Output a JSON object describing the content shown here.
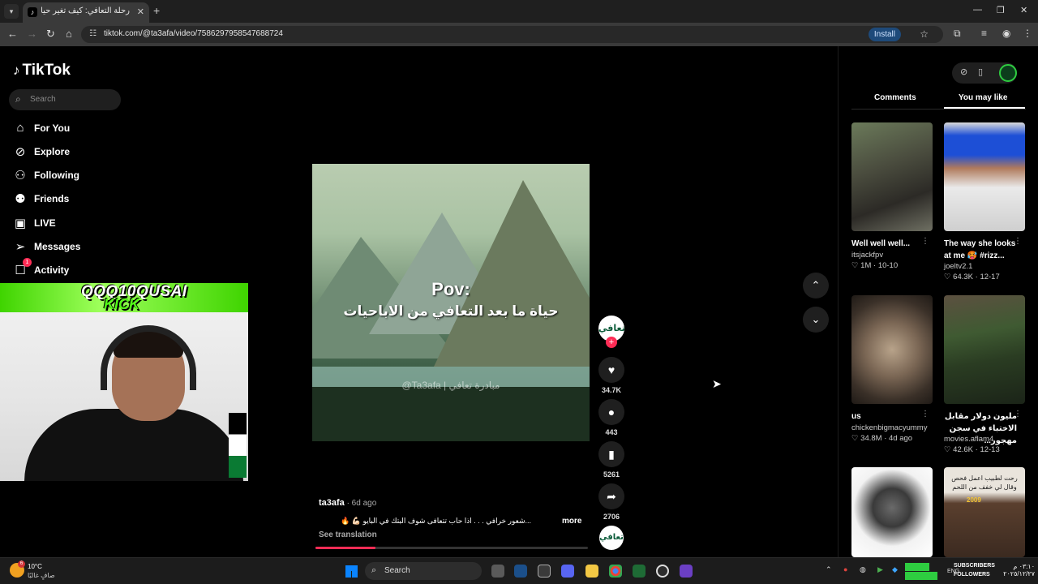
{
  "browser": {
    "tab_title": "رحلة التعافي: كيف تغير حياتك",
    "url": "tiktok.com/@ta3afa/video/7586297958547688724",
    "install_label": "Install"
  },
  "tiktok": {
    "logo": "TikTok",
    "search_placeholder": "Search",
    "nav": [
      {
        "label": "For You"
      },
      {
        "label": "Explore"
      },
      {
        "label": "Following"
      },
      {
        "label": "Friends"
      },
      {
        "label": "LIVE"
      },
      {
        "label": "Messages"
      },
      {
        "label": "Activity",
        "badge": "1"
      }
    ]
  },
  "stream_overlay": {
    "name": "QQQ10QUSAI",
    "platform": "KICK"
  },
  "video": {
    "caption_line1": "Pov:",
    "caption_line2": "حياة ما بعد التعافي من الاباحيات",
    "watermark": "@Ta3afa | مبادرة تعافي",
    "avatar_text": "تعافي",
    "author": "ta3afa",
    "date": " · 6d ago",
    "description": "...شعور خرافي . . . اذا حاب تتعافى شوف البتك في البايو 💪🏻 🔥",
    "more_label": "more",
    "see_translation": "See translation",
    "progress": 0.22,
    "likes": "34.7K",
    "comments": "443",
    "saves": "5261",
    "shares": "2706"
  },
  "right_panel": {
    "tab_comments": "Comments",
    "tab_you_may_like": "You may like",
    "cards": [
      {
        "title": "Well well well...",
        "user": "itsjackfpv",
        "likes": "1M",
        "date": "10-10"
      },
      {
        "title": "The way she looks at me 🥵 #rizz...",
        "user": "joeltv2.1",
        "likes": "64.3K",
        "date": "12-17"
      },
      {
        "title": "us",
        "user": "chickenbigmacyummy",
        "likes": "34.8M",
        "date": "4d ago"
      },
      {
        "title": "مليون دولار مقابل الاختباء في سجن مهجور...",
        "user": "movies.aflam4",
        "likes": "42.6K",
        "date": "12-13"
      },
      {
        "title": "",
        "user": "",
        "likes": "",
        "date": ""
      },
      {
        "title": "",
        "user": "",
        "likes": "",
        "date": "",
        "overlay_text": "رحت لطبيب اعمل فحص وقال لي خفف من اللحم",
        "overlay_year": "2009"
      }
    ]
  },
  "taskbar": {
    "temperature": "10°C",
    "weather": "صافٍ غالبًا",
    "weather_badge": "6",
    "search_label": "Search",
    "subscribers_label": "SUBSCRIBERS",
    "followers_label": "FOLLOWERS",
    "lang": "ENG",
    "time": "٠٣:١٠ م",
    "date": "٢٠٢٥/١٢/٢٧"
  },
  "colors": {
    "accent": "#fe2c55",
    "kick_green": "#53fc18",
    "background": "#000000"
  }
}
